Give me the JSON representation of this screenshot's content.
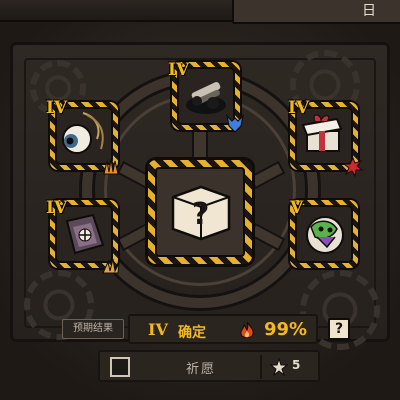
{
  "header": {
    "title_fragment": "日"
  },
  "slots": [
    {
      "name": "top",
      "tier": "IV",
      "item_icon": "dark-bullet-pile-icon",
      "badge_icon": "blue-demon-icon"
    },
    {
      "name": "upper-left",
      "tier": "IV",
      "item_icon": "eyeball-icon",
      "badge_icon": "orange-claw-icon"
    },
    {
      "name": "upper-right",
      "tier": "IV",
      "item_icon": "gift-box-icon",
      "badge_icon": "red-splat-icon"
    },
    {
      "name": "lower-left",
      "tier": "IV",
      "item_icon": "spellbook-icon",
      "badge_icon": "claw-scratch-icon"
    },
    {
      "name": "lower-right",
      "tier": "V",
      "item_icon": "green-creature-icon",
      "badge_icon": ""
    }
  ],
  "center": {
    "symbol": "?"
  },
  "result": {
    "tag": "预期结果",
    "tier": "IV",
    "label": "确定",
    "percent": "99%",
    "help": "?"
  },
  "wish": {
    "label": "祈愿",
    "count": "5",
    "checked": false
  },
  "colors": {
    "accent": "#f2b81e",
    "hazard_stripe": "#e7b22a",
    "background": "#1e1915"
  }
}
